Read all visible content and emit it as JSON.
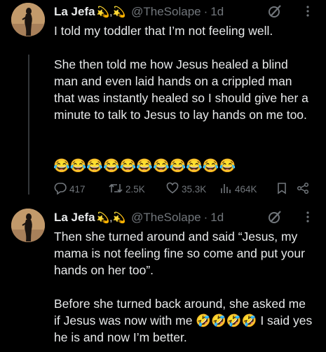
{
  "tweets": [
    {
      "author": "La Jefa",
      "name_emoji": "💫,💫",
      "handle": "@TheSolape",
      "separator": "·",
      "time": "1d",
      "paragraphs": [
        "I told my toddler that I’m not feeling well.",
        "She then told me how Jesus healed a blind man and even laid hands on a crippled man that was instantly healed so I should give her a minute to talk to Jesus to lay hands on me too."
      ],
      "emoji_line": "😂😂😂😂😂😂😂😂😂😂😂",
      "stats": {
        "replies": "417",
        "reposts": "2.5K",
        "likes": "35.3K",
        "views": "464K"
      }
    },
    {
      "author": "La Jefa",
      "name_emoji": "💫,💫",
      "handle": "@TheSolape",
      "separator": "·",
      "time": "1d",
      "paragraphs": [
        "Then she turned around and said “Jesus, my mama is not feeling fine so come and put your hands on her too”.",
        "Before she turned back around, she asked me if Jesus was now with me 🤣🤣🤣🤣 I said yes he is and now I’m better."
      ]
    }
  ],
  "icons": {
    "grok": "grok-icon",
    "more": "more-icon",
    "reply": "reply-icon",
    "repost": "repost-icon",
    "like": "heart-icon",
    "views": "views-icon",
    "bookmark": "bookmark-icon",
    "share": "share-icon"
  },
  "colors": {
    "background": "#000000",
    "text": "#e7e9ea",
    "muted": "#71767b"
  }
}
